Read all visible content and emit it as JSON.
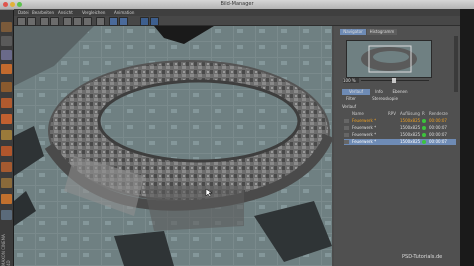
{
  "window": {
    "title": "Bild-Manager"
  },
  "menu": [
    "Datei",
    "Bearbeiten",
    "Ansicht",
    "Vergleichen",
    "Animation"
  ],
  "toolbar_icons": [
    "render-icon",
    "stop-icon",
    "compare-a-icon",
    "compare-b-icon",
    "channel-r-icon",
    "channel-g-icon",
    "channel-b-icon",
    "alpha-icon",
    "zoom-icon",
    "fit-icon"
  ],
  "panel": {
    "tabs": [
      "Navigator",
      "Histogramm"
    ],
    "zoom_value": "100 %",
    "subtabs": [
      "Verlauf",
      "Info",
      "Ebenen",
      "Filter",
      "Stereoskopie"
    ],
    "history_title": "Verlauf",
    "columns": {
      "name": "Name",
      "rpv": "RPV",
      "resolution": "Auflösung",
      "r": "R",
      "render": "Renderze"
    },
    "rows": [
      {
        "name": "Feuerwerk *",
        "resolution": "1500x825",
        "time": "00:00:07",
        "highlight": true
      },
      {
        "name": "Feuerwerk *",
        "resolution": "1500x825",
        "time": "00:00:07",
        "highlight": false
      },
      {
        "name": "Feuerwerk *",
        "resolution": "1500x825",
        "time": "00:00:07",
        "highlight": false
      },
      {
        "name": "Feuerwerk *",
        "resolution": "1500x825",
        "time": "00:00:07",
        "highlight": false
      }
    ]
  },
  "left_strip_text": "MAXON CINEMA 4D",
  "watermark": "PSD-Tutorials.de",
  "colors": {
    "accent_orange": "#f0a020",
    "status_green": "#3cc43c",
    "selection_blue": "#6e8bb5"
  }
}
